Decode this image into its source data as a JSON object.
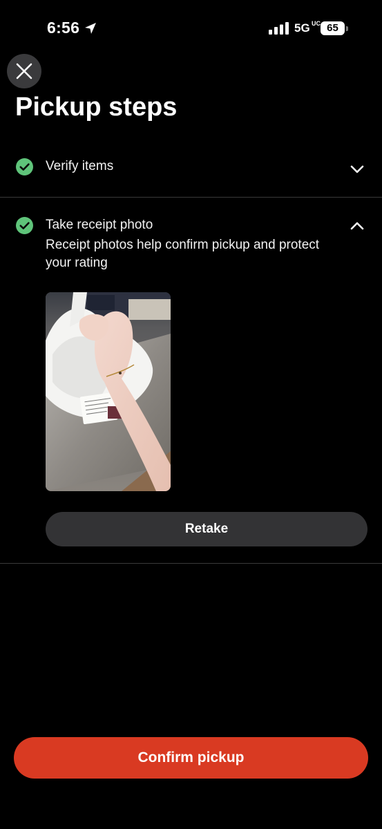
{
  "status_bar": {
    "time": "6:56",
    "network": "5G",
    "network_suffix": "UC",
    "battery": "65"
  },
  "icons": {
    "close": "close-icon",
    "location": "location-arrow-icon",
    "check": "check-circle-icon",
    "chevron_down": "chevron-down-icon",
    "chevron_up": "chevron-up-icon"
  },
  "header": {
    "title": "Pickup steps"
  },
  "steps": [
    {
      "label": "Verify items",
      "completed": true,
      "expanded": false
    },
    {
      "label": "Take receipt photo",
      "completed": true,
      "expanded": true,
      "description": "Receipt photos help confirm pickup and protect your rating",
      "retake_label": "Retake"
    }
  ],
  "footer": {
    "confirm_label": "Confirm pickup"
  },
  "colors": {
    "background": "#000000",
    "check": "#5fc47a",
    "confirm": "#d93a22",
    "secondary_button": "#333335"
  }
}
